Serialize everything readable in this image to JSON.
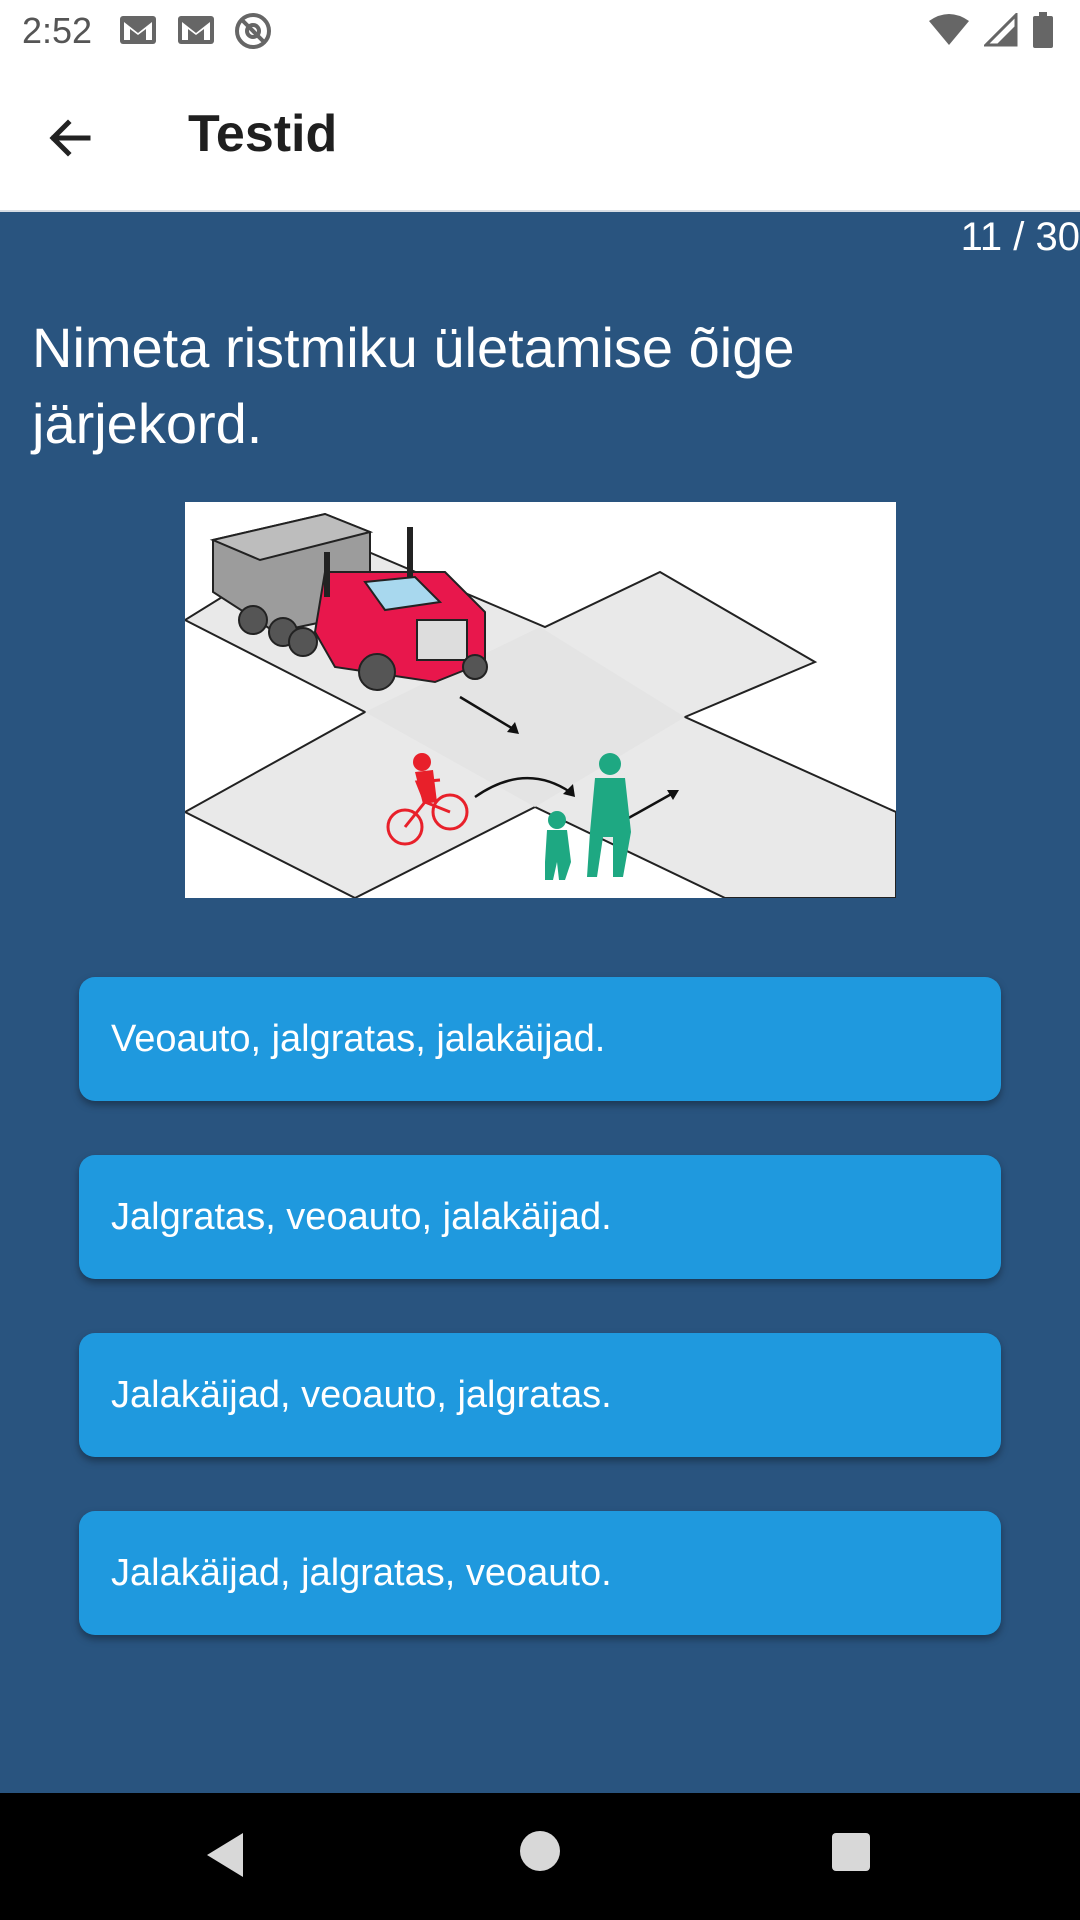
{
  "status_bar": {
    "time": "2:52",
    "left_icons": [
      "gmail-icon",
      "gmail-icon",
      "at-sign-icon"
    ],
    "right_icons": [
      "wifi-icon",
      "cell-signal-icon",
      "battery-icon"
    ]
  },
  "app_bar": {
    "title": "Testid",
    "back_icon": "arrow-left-icon"
  },
  "quiz": {
    "counter": "11 / 30",
    "question": "Nimeta ristmiku ületamise õige järjekord.",
    "answers": [
      "Veoauto, jalgratas, jalakäijad.",
      "Jalgratas, veoauto, jalakäijad.",
      "Jalakäijad, veoauto, jalgratas.",
      "Jalakäijad, jalgratas, veoauto."
    ]
  },
  "colors": {
    "background": "#29547f",
    "answer_button": "#1f99de",
    "truck": "#e8174c",
    "cyclist": "#e8202a",
    "pedestrians": "#1ea882"
  },
  "nav_bar": {
    "icons": [
      "nav-back-icon",
      "nav-home-icon",
      "nav-recents-icon"
    ]
  }
}
